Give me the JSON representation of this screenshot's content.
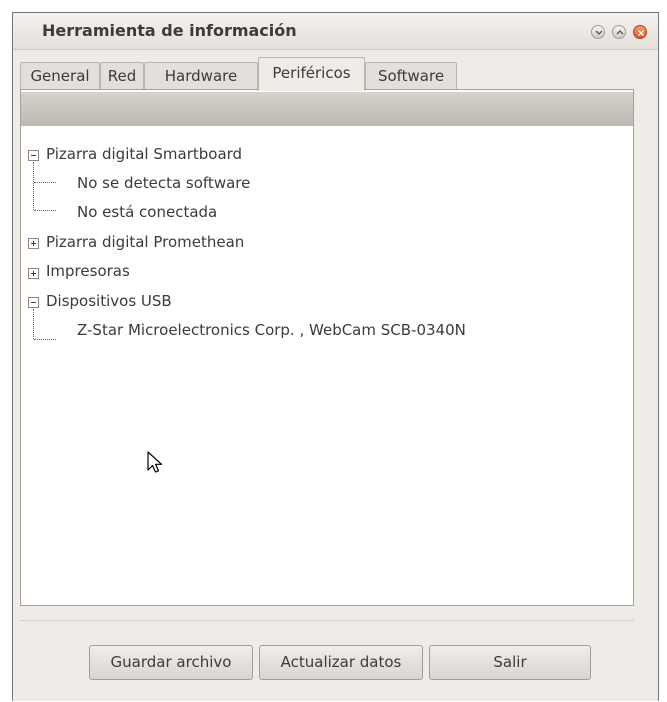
{
  "window": {
    "title": "Herramienta de información"
  },
  "tabs": [
    {
      "label": "General"
    },
    {
      "label": "Red"
    },
    {
      "label": "Hardware"
    },
    {
      "label": "Periféricos",
      "active": true
    },
    {
      "label": "Software"
    }
  ],
  "tree": {
    "groups": [
      {
        "label": "Pizarra digital Smartboard",
        "expanded": true,
        "children": [
          "No se detecta software",
          "No está conectada"
        ]
      },
      {
        "label": "Pizarra digital Promethean",
        "expanded": false
      },
      {
        "label": "Impresoras",
        "expanded": false
      },
      {
        "label": "Dispositivos USB",
        "expanded": true,
        "children": [
          "Z-Star Microelectronics Corp. , WebCam SCB-0340N"
        ]
      }
    ]
  },
  "buttons": {
    "save": "Guardar archivo",
    "refresh": "Actualizar datos",
    "exit": "Salir"
  },
  "colors": {
    "header": "#c7c2bc",
    "close_button": "#e45b26",
    "background": "#efebe7"
  }
}
